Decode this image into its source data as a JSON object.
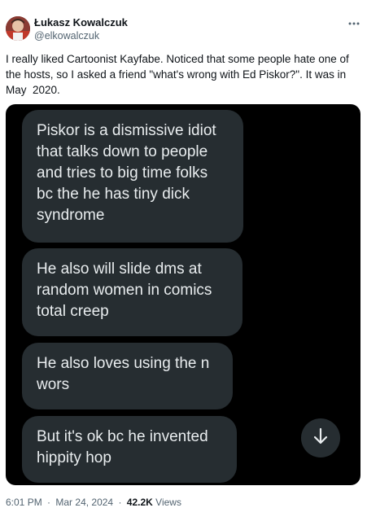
{
  "author": {
    "name": "Łukasz Kowalczuk",
    "handle": "@elkowalczuk"
  },
  "tweet": {
    "text": "I really liked Cartoonist Kayfabe. Noticed that some people hate one of\nthe hosts, so I asked a friend \"what's wrong with Ed Piskor?\". It was in\nMay  2020."
  },
  "media": {
    "messages": [
      "Piskor is a dismissive idiot\nthat talks down to people\nand tries to big time folks\nbc the he has tiny dick\nsyndrome",
      "He also will slide dms at\nrandom women in comics\ntotal creep",
      "He also loves using the n\nwors",
      "But it's ok bc he invented\nhippity hop"
    ],
    "scroll_icon": "arrow-down-icon"
  },
  "meta": {
    "time": "6:01 PM",
    "separator": "·",
    "date": "Mar 24, 2024",
    "views_count": "42.2K",
    "views_label": "Views"
  },
  "icons": {
    "more": "more-horizontal-icon"
  },
  "colors": {
    "text_primary": "#0f1419",
    "text_secondary": "#536471",
    "bubble_bg": "#262d31",
    "bubble_text": "#e9edef",
    "media_bg": "#000000"
  }
}
